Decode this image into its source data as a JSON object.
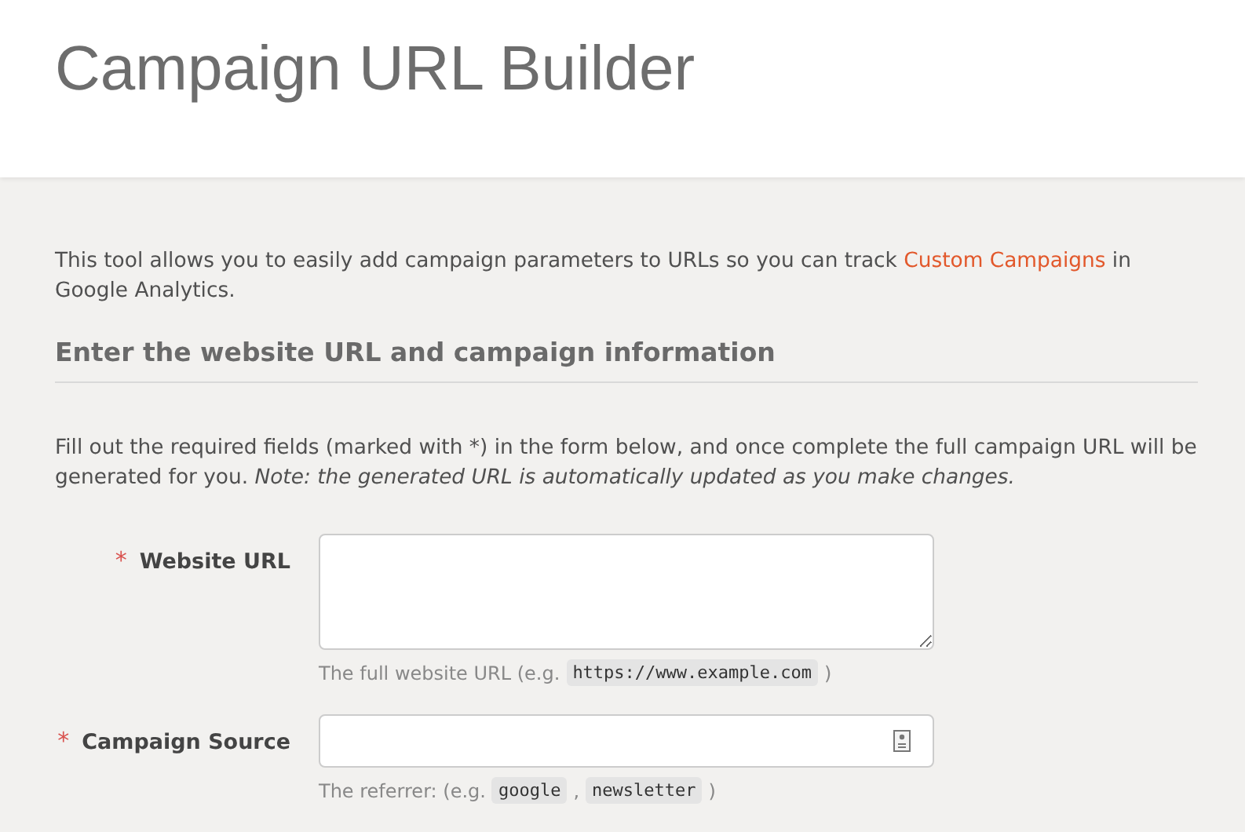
{
  "header": {
    "title": "Campaign URL Builder"
  },
  "intro": [
    {
      "kind": "text",
      "text": "This tool allows you to easily add campaign parameters to URLs so you can track "
    },
    {
      "kind": "link",
      "text": "Custom Campaigns"
    },
    {
      "kind": "text",
      "text": " in Google Analytics."
    }
  ],
  "section": {
    "heading": "Enter the website URL and campaign information",
    "instructions": "Fill out the required fields (marked with *) in the form below, and once complete the full campaign URL will be generated for you. *Note: the generated URL is automatically updated as you make changes.*"
  },
  "fields": [
    {
      "kind": "textarea",
      "label": "Website URL",
      "required": true,
      "required_mark": "*",
      "hint": [
        {
          "kind": "text",
          "text": "The full website URL (e.g."
        },
        {
          "kind": "code",
          "text": "https://www.example.com"
        },
        {
          "kind": "text",
          "text": ")"
        }
      ]
    },
    {
      "kind": "input",
      "label": "Campaign Source",
      "required": true,
      "required_mark": "*",
      "hint": [
        {
          "kind": "text",
          "text": "The referrer: (e.g."
        },
        {
          "kind": "code",
          "text": "google"
        },
        {
          "kind": "text",
          "text": ","
        },
        {
          "kind": "code",
          "text": "newsletter"
        },
        {
          "kind": "text",
          "text": ")"
        }
      ]
    }
  ]
}
